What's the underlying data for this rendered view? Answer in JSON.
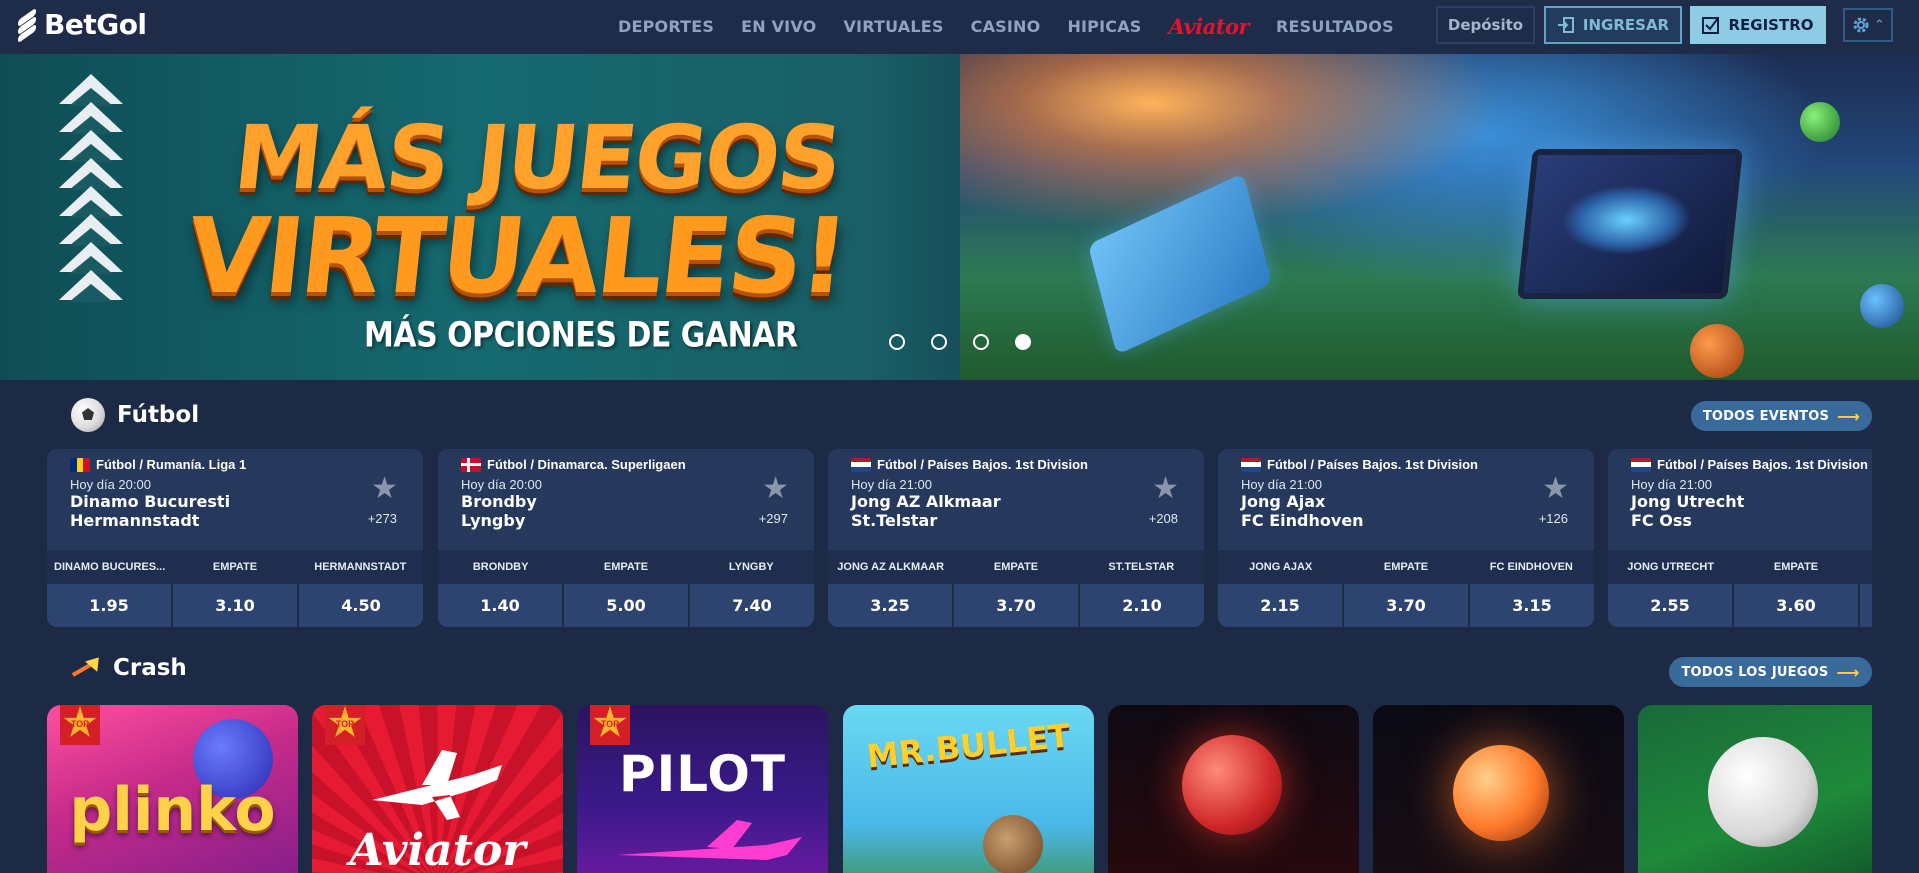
{
  "header": {
    "logo": "BetGol",
    "nav": [
      "DEPORTES",
      "EN VIVO",
      "VIRTUALES",
      "CASINO",
      "HIPICAS",
      "Aviator",
      "RESULTADOS"
    ],
    "deposit_label": "Depósito",
    "login_label": "INGRESAR",
    "register_label": "REGISTRO"
  },
  "banner": {
    "title_line1": "MÁS JUEGOS",
    "title_line2": "VIRTUALES!",
    "subtitle": "MÁS OPCIONES DE GANAR",
    "slides": 4,
    "active_slide": 4
  },
  "football": {
    "title": "Fútbol",
    "all_events_label": "TODOS EVENTOS",
    "matches": [
      {
        "league": "Fútbol / Rumanía. Liga 1",
        "flag": "romania",
        "time": "Hoy día 20:00",
        "home": "Dinamo Bucuresti",
        "away": "Hermannstadt",
        "more": "+273",
        "labels": [
          "DINAMO BUCURES...",
          "EMPATE",
          "HERMANNSTADT"
        ],
        "odds": [
          "1.95",
          "3.10",
          "4.50"
        ]
      },
      {
        "league": "Fútbol / Dinamarca. Superligaen",
        "flag": "denmark",
        "time": "Hoy día 20:00",
        "home": "Brondby",
        "away": "Lyngby",
        "more": "+297",
        "labels": [
          "BRONDBY",
          "EMPATE",
          "LYNGBY"
        ],
        "odds": [
          "1.40",
          "5.00",
          "7.40"
        ]
      },
      {
        "league": "Fútbol / Países Bajos. 1st Division",
        "flag": "netherlands",
        "time": "Hoy día 21:00",
        "home": "Jong AZ Alkmaar",
        "away": "St.Telstar",
        "more": "+208",
        "labels": [
          "JONG AZ ALKMAAR",
          "EMPATE",
          "ST.TELSTAR"
        ],
        "odds": [
          "3.25",
          "3.70",
          "2.10"
        ]
      },
      {
        "league": "Fútbol / Países Bajos. 1st Division",
        "flag": "netherlands",
        "time": "Hoy día 21:00",
        "home": "Jong Ajax",
        "away": "FC Eindhoven",
        "more": "+126",
        "labels": [
          "JONG AJAX",
          "EMPATE",
          "FC EINDHOVEN"
        ],
        "odds": [
          "2.15",
          "3.70",
          "3.15"
        ]
      },
      {
        "league": "Fútbol / Países Bajos. 1st Division",
        "flag": "netherlands",
        "time": "Hoy día 21:00",
        "home": "Jong Utrecht",
        "away": "FC Oss",
        "more": "",
        "labels": [
          "JONG UTRECHT",
          "EMPATE",
          ""
        ],
        "odds": [
          "2.55",
          "3.60",
          ""
        ]
      }
    ]
  },
  "crash": {
    "title": "Crash",
    "all_games_label": "TODOS LOS JUEGOS",
    "top_badge": "TOP",
    "games": [
      {
        "name": "plinko",
        "title": "plinko",
        "top": true
      },
      {
        "name": "aviator",
        "title": "Aviator",
        "top": true
      },
      {
        "name": "pilot",
        "title": "PILOT",
        "top": true
      },
      {
        "name": "mr-bullet",
        "title": "MR.BULLET",
        "top": false
      },
      {
        "name": "cricket",
        "title": "",
        "top": false
      },
      {
        "name": "football-fire",
        "title": "",
        "top": false
      },
      {
        "name": "football-x",
        "title": "",
        "top": false
      }
    ]
  }
}
